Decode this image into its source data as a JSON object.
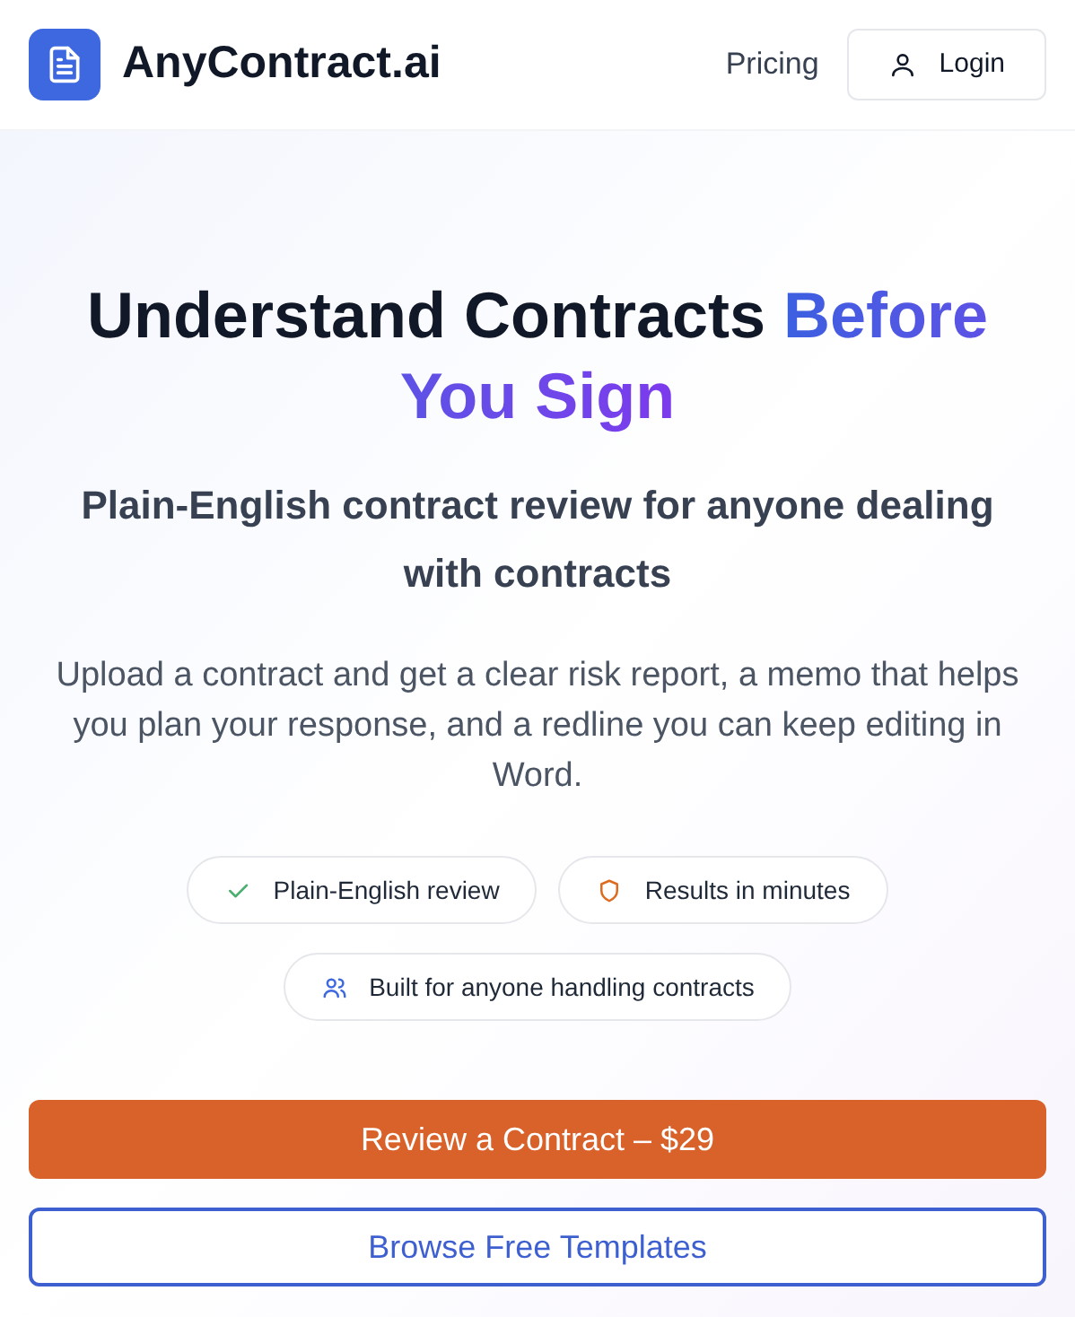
{
  "header": {
    "brand": "AnyContract.ai",
    "nav": [
      {
        "label": "Pricing",
        "kind": "link"
      },
      {
        "label": "Login",
        "kind": "button"
      }
    ]
  },
  "hero": {
    "title": "Understand Contracts ",
    "title_highlight": "Before You Sign",
    "subtitle": "Plain-English contract review for anyone dealing with contracts",
    "description": "Upload a contract and get a clear risk report, a memo that helps you plan your response, and a redline you can keep editing in Word.",
    "badges": [
      {
        "label": "Plain-English review",
        "kind": "check"
      },
      {
        "label": "Results in minutes",
        "kind": "shield"
      },
      {
        "label": "Built for anyone handling contracts",
        "kind": "users"
      }
    ],
    "buttons": [
      {
        "label": "Review a Contract – $29",
        "kind": "primary"
      },
      {
        "label": "Browse Free Templates",
        "kind": "secondary"
      }
    ]
  }
}
